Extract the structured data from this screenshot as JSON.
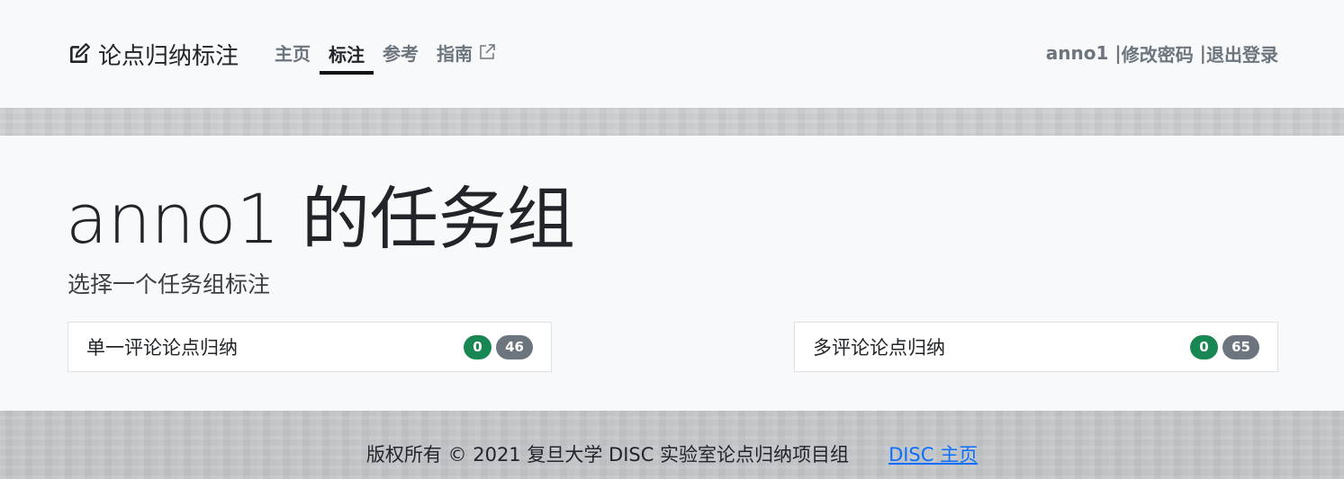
{
  "header": {
    "brand": "论点归纳标注",
    "nav": [
      {
        "label": "主页",
        "active": false
      },
      {
        "label": "标注",
        "active": true
      },
      {
        "label": "参考",
        "active": false
      },
      {
        "label": "指南",
        "active": false,
        "external": true
      }
    ],
    "user": {
      "username": "anno1",
      "separator": " |",
      "change_password": "修改密码",
      "logout": "退出登录"
    }
  },
  "main": {
    "title": "anno1 的任务组",
    "subtitle": "选择一个任务组标注",
    "task_groups": [
      {
        "name": "单一评论论点归纳",
        "done": "0",
        "total": "46"
      },
      {
        "name": "多评论论点归纳",
        "done": "0",
        "total": "65"
      }
    ]
  },
  "footer": {
    "copyright": "版权所有 © 2021 复旦大学 DISC 实验室论点归纳项目组",
    "link": "DISC 主页"
  },
  "colors": {
    "done_badge": "#198754",
    "total_badge": "#6c757d",
    "link": "#0d6efd",
    "panel_bg": "#f8f9fa"
  },
  "icons": {
    "brand": "edit-square-icon",
    "external": "external-link-icon"
  }
}
